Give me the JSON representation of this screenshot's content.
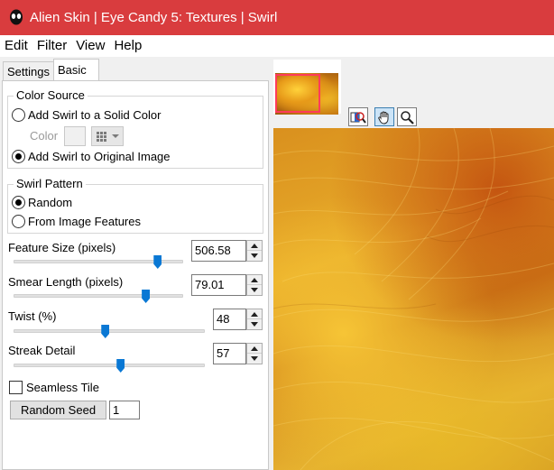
{
  "window": {
    "title": "Alien Skin | Eye Candy 5: Textures | Swirl"
  },
  "menu": {
    "items": [
      "Edit",
      "Filter",
      "View",
      "Help"
    ]
  },
  "tabs": {
    "settings": "Settings",
    "basic": "Basic",
    "active": "Basic"
  },
  "color_source": {
    "title": "Color Source",
    "option_solid": "Add Swirl to a Solid Color",
    "color_label": "Color",
    "option_original": "Add Swirl to Original Image",
    "selected": "Add Swirl to Original Image"
  },
  "swirl_pattern": {
    "title": "Swirl Pattern",
    "option_random": "Random",
    "option_features": "From Image Features",
    "selected": "Random"
  },
  "params": {
    "feature_size": {
      "label": "Feature Size (pixels)",
      "value": "506.58",
      "slider_fraction": 0.85
    },
    "smear_length": {
      "label": "Smear Length (pixels)",
      "value": "79.01",
      "slider_fraction": 0.78
    },
    "twist": {
      "label": "Twist (%)",
      "value": "48",
      "slider_fraction": 0.48
    },
    "streak_detail": {
      "label": "Streak Detail",
      "value": "57",
      "slider_fraction": 0.56
    }
  },
  "seamless_tile": {
    "label": "Seamless Tile",
    "checked": false
  },
  "random_seed": {
    "button_label": "Random Seed",
    "value": "1"
  },
  "preview": {
    "tools": [
      "preview-compare-icon",
      "hand-icon",
      "zoom-icon"
    ],
    "active_tool": "hand-icon"
  },
  "colors": {
    "titlebar": "#d93c3e",
    "slider_thumb": "#0a78d4",
    "thumbnail_rect": "#ff3b5a"
  }
}
